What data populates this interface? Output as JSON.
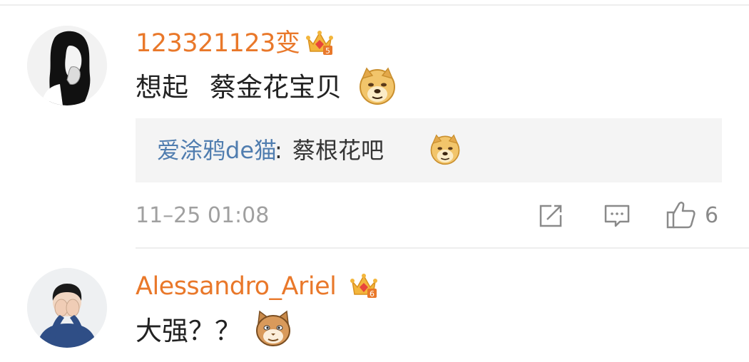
{
  "comments": [
    {
      "username": "123321123变",
      "text_part1": "想起",
      "text_part2": "蔡金花宝贝",
      "emoji": "doge-emoji",
      "badge": "crown-badge",
      "badge_level": "5",
      "reply": {
        "author": "爱涂鸦de猫",
        "separator": ":",
        "text": "蔡根花吧",
        "emoji": "doge-emoji"
      },
      "timestamp": "11–25 01:08",
      "actions": {
        "repost_icon": "repost-icon",
        "comment_icon": "comment-icon",
        "like_icon": "thumbs-up-icon",
        "like_count": "6"
      }
    },
    {
      "username": "Alessandro_Ariel",
      "text": "大强？？",
      "emoji": "cat-emoji",
      "badge": "crown-badge",
      "badge_level": "6"
    }
  ],
  "colors": {
    "username": "#e9782a",
    "reply_author": "#507daf",
    "text": "#222222",
    "meta": "#a0a0a0",
    "reply_bg": "#f4f4f4"
  }
}
